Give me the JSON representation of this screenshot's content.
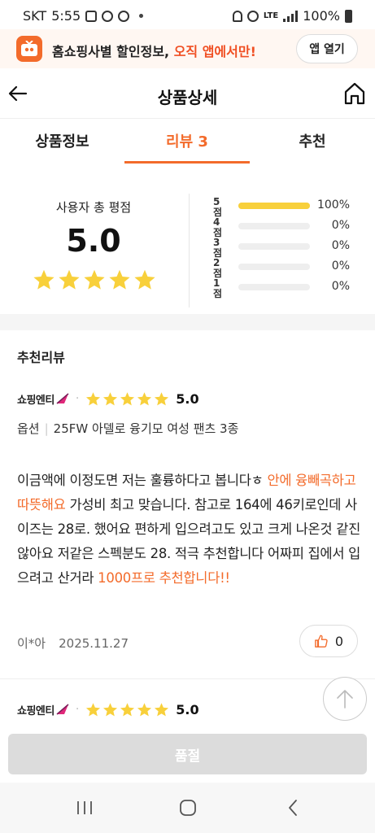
{
  "status_bar": {
    "carrier": "SKT",
    "time": "5:55",
    "network": "LTE",
    "battery": "100%"
  },
  "promo_banner": {
    "text_prefix": "홈쇼핑사별 할인정보, ",
    "text_highlight": "오직 앱에서만!",
    "open_button": "앱 열기"
  },
  "header": {
    "title": "상품상세"
  },
  "tabs": [
    {
      "label": "상품정보"
    },
    {
      "label": "리뷰 3"
    },
    {
      "label": "추천"
    }
  ],
  "rating_summary": {
    "label": "사용자 총 평점",
    "score": "5.0",
    "stars": 5,
    "distribution": [
      {
        "label": "5점",
        "percent_label": "100%",
        "fraction": 1.0
      },
      {
        "label": "4점",
        "percent_label": "0%",
        "fraction": 0
      },
      {
        "label": "3점",
        "percent_label": "0%",
        "fraction": 0
      },
      {
        "label": "2점",
        "percent_label": "0%",
        "fraction": 0
      },
      {
        "label": "1점",
        "percent_label": "0%",
        "fraction": 0
      }
    ]
  },
  "recommended_reviews": {
    "heading": "추천리뷰",
    "reviews": [
      {
        "brand": "쇼핑엔티",
        "stars": 5,
        "score": "5.0",
        "option_label": "옵션",
        "option_value": "25FW 아델로 융기모 여성 팬츠 3종",
        "body_part1": "이금액에 이정도면 저는 훌륭하다고 봅니다ㅎ ",
        "body_highlight1": "안에 융빼곡하고 따뜻해요",
        "body_part2": " 가성비 최고 맞습니다. 참고로 164에 46키로인데 사이즈는 28로. 했어요 편하게 입으려고도 있고 크게 나온것 같진 않아요 저같은 스펙분도 28. 적극 추천합니다 어짜피 집에서 입으려고 산거라 ",
        "body_highlight2": "1000프로 추천합니다!!",
        "author": "이*아",
        "date": "2025.11.27",
        "likes": "0"
      },
      {
        "brand": "쇼핑엔티",
        "stars": 5,
        "score": "5.0"
      }
    ]
  },
  "bottom_button": {
    "label": "품절"
  },
  "colors": {
    "accent": "#f36b2b",
    "star": "#f8d03b",
    "promo_bg": "#fff7f2"
  },
  "icons": [
    "back-arrow-icon",
    "home-icon",
    "star-icon",
    "thumbs-up-icon",
    "arrow-up-icon",
    "recent-apps-icon",
    "home-circle-icon",
    "back-chevron-icon"
  ]
}
